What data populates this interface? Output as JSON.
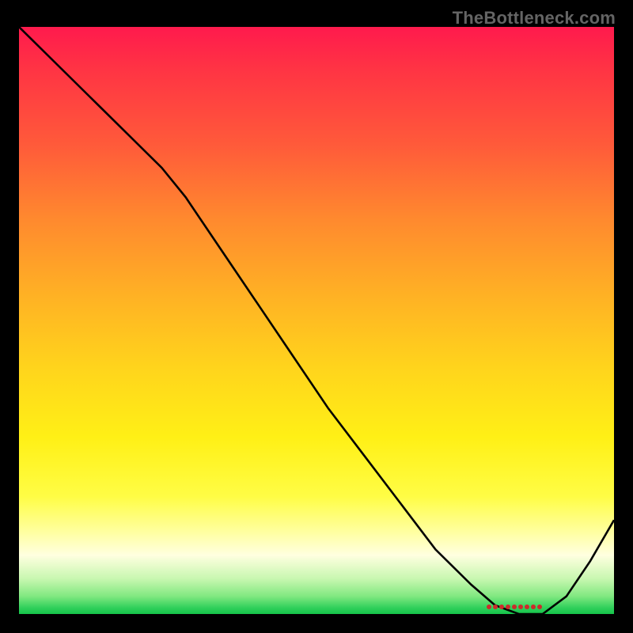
{
  "watermark": "TheBottleneck.com",
  "marker_label": "",
  "chart_data": {
    "type": "line",
    "title": "",
    "xlabel": "",
    "ylabel": "",
    "xlim": [
      0,
      100
    ],
    "ylim": [
      0,
      100
    ],
    "grid": false,
    "series": [
      {
        "name": "curve",
        "x": [
          0,
          6,
          12,
          18,
          24,
          28,
          34,
          40,
          46,
          52,
          58,
          64,
          70,
          76,
          80,
          84,
          88,
          92,
          96,
          100
        ],
        "y": [
          100,
          94,
          88,
          82,
          76,
          71,
          62,
          53,
          44,
          35,
          27,
          19,
          11,
          5,
          1.5,
          0,
          0,
          3,
          9,
          16
        ]
      }
    ],
    "annotations": [
      {
        "name": "optimum-marker",
        "x": 85,
        "y": 1.5,
        "color": "#cc2b2b"
      }
    ],
    "background_gradient": {
      "direction": "vertical",
      "stops": [
        {
          "pos": 0.0,
          "color": "#ff1a4d"
        },
        {
          "pos": 0.2,
          "color": "#ff5a3a"
        },
        {
          "pos": 0.46,
          "color": "#ffb224"
        },
        {
          "pos": 0.7,
          "color": "#fff016"
        },
        {
          "pos": 0.9,
          "color": "#ffffe0"
        },
        {
          "pos": 1.0,
          "color": "#15c44a"
        }
      ]
    }
  }
}
